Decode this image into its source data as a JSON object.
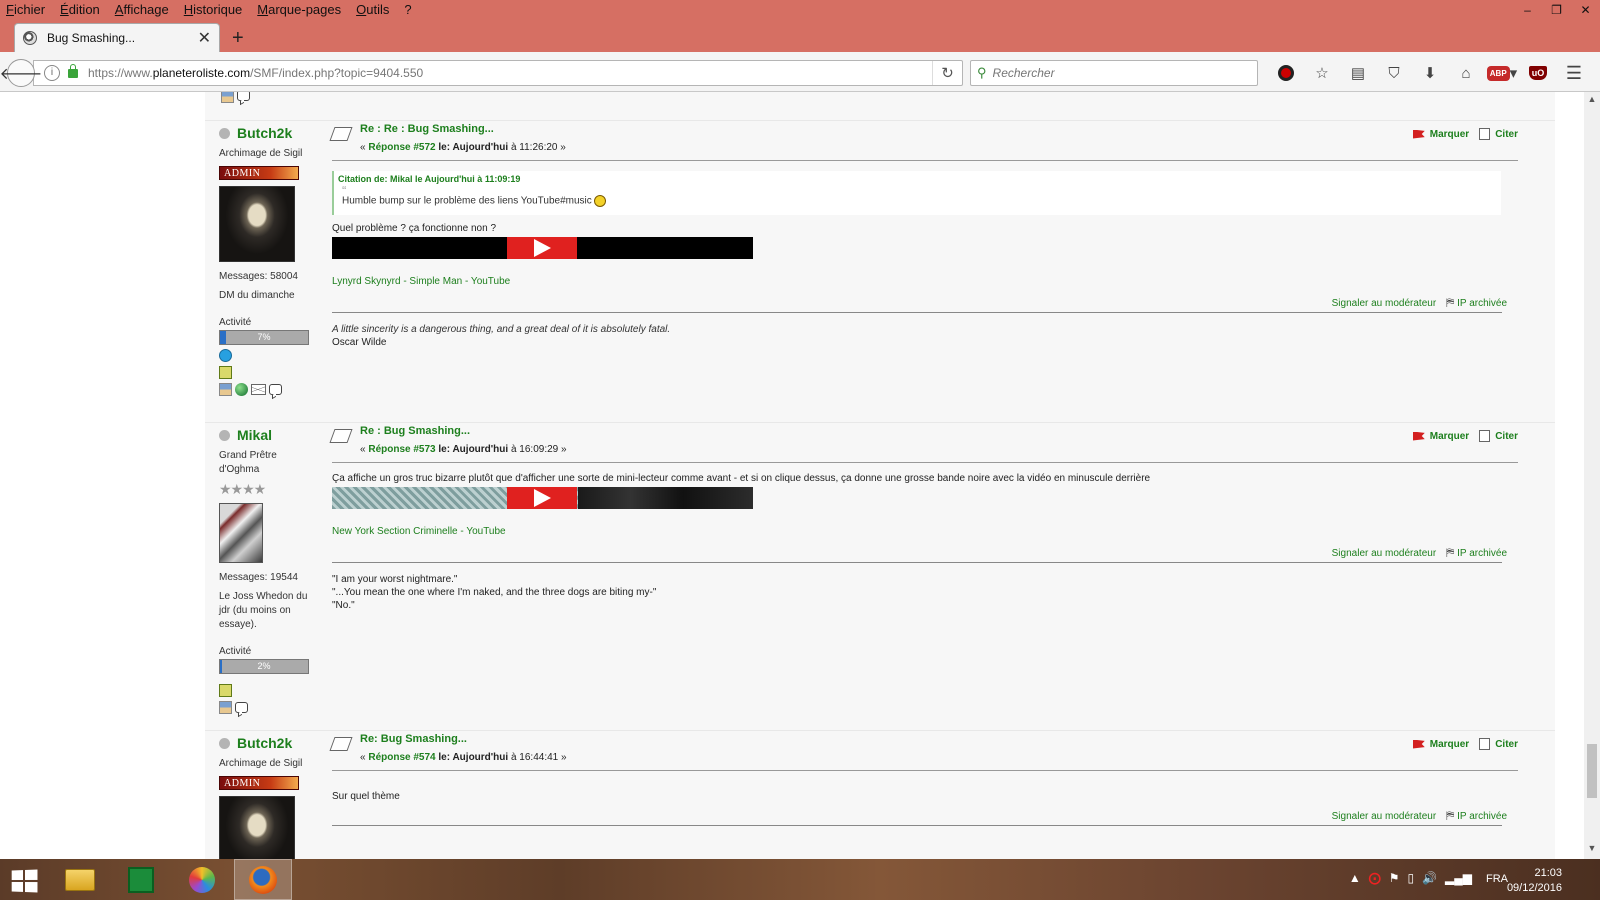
{
  "menu": [
    "Fichier",
    "Édition",
    "Affichage",
    "Historique",
    "Marque-pages",
    "Outils",
    "?"
  ],
  "window_controls": {
    "minimize": "–",
    "restore": "❐",
    "close": "✕"
  },
  "tab": {
    "title": "Bug Smashing...",
    "close": "✕",
    "new_tab": "+"
  },
  "nav": {
    "url_prefix": "https://www.",
    "url_domain": "planeteroliste.com",
    "url_path": "/SMF/index.php?topic=9404.550",
    "search_placeholder": "Rechercher",
    "icons": [
      "record-icon",
      "star-icon",
      "reader-icon",
      "pocket-icon",
      "download-icon",
      "home-icon",
      "adblock-icon",
      "ublock-icon",
      "menu-icon"
    ]
  },
  "labels": {
    "mark": "Marquer",
    "quote": "Citer",
    "report": "Signaler au modérateur",
    "ip": "IP archivée",
    "activity": "Activité",
    "admin_badge": "ADMIN"
  },
  "posts": [
    {
      "author": "Butch2k",
      "title": "Archimage de Sigil",
      "messages": "Messages: 58004",
      "custom": "DM du dimanche",
      "activity_percent": 7,
      "activity_text": "7%",
      "subject": "Re : Re : Bug Smashing...",
      "info_prefix": "« ",
      "reply": "Réponse #572",
      "date_label": " le: Aujourd'hui",
      "time": " à 11:26:20 »",
      "quote_head": "Citation de: Mikal le Aujourd'hui à 11:09:19",
      "quote_text": "Humble bump sur le problème des liens YouTube#music",
      "text": "Quel problème ? ça fonctionne non ?",
      "video_link": "Lynyrd Skynyrd - Simple Man - YouTube",
      "sig_italic": "A little sincerity is a dangerous thing, and a great deal of it is absolutely fatal.",
      "sig_author": "Oscar Wilde"
    },
    {
      "author": "Mikal",
      "title": "Grand Prêtre d'Oghma",
      "stars": "★★★★",
      "messages": "Messages: 19544",
      "custom": "Le Joss Whedon du jdr (du moins on essaye).",
      "activity_percent": 2,
      "activity_text": "2%",
      "subject": "Re : Bug Smashing...",
      "info_prefix": "« ",
      "reply": "Réponse #573",
      "date_label": " le: Aujourd'hui",
      "time": " à 16:09:29 »",
      "text": "Ça affiche un gros truc bizarre plutôt que d'afficher une sorte de mini-lecteur comme avant - et si on clique dessus, ça donne une grosse bande noire avec la vidéo en minuscule derrière",
      "video_link": "New York Section Criminelle - YouTube",
      "sig_lines": [
        "\"I am your worst nightmare.\"",
        "\"...You mean the one where I'm naked, and the three dogs are biting my-\"",
        "\"No.\""
      ]
    },
    {
      "author": "Butch2k",
      "title": "Archimage de Sigil",
      "subject": "Re: Bug Smashing...",
      "info_prefix": "« ",
      "reply": "Réponse #574",
      "date_label": " le: Aujourd'hui",
      "time": " à 16:44:41 »",
      "text": "Sur quel thème"
    }
  ],
  "taskbar": {
    "apps": [
      "windows-start",
      "file-explorer",
      "store",
      "picasa",
      "firefox"
    ],
    "tray": {
      "arrow": "▲",
      "flag": "⚑",
      "battery": "▯",
      "volume": "🔊",
      "signal": "▂▄▆"
    },
    "lang": "FRA",
    "time": "21:03",
    "date": "09/12/2016"
  }
}
